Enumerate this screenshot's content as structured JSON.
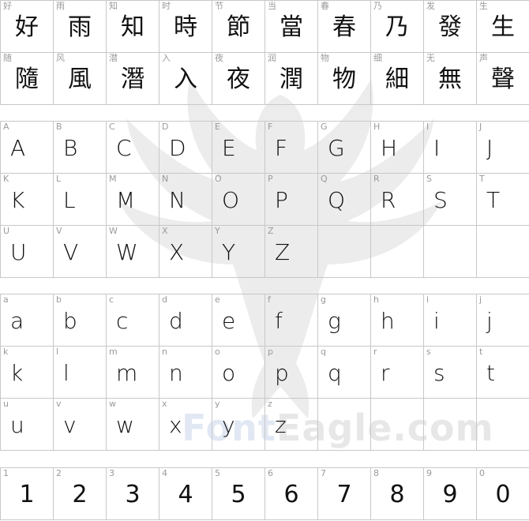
{
  "watermark": {
    "font_word": "Font",
    "eagle_word": "Eagle.com",
    "eagle_icon": "eagle-silhouette-icon"
  },
  "hanzi": {
    "labels": [
      "好",
      "雨",
      "知",
      "时",
      "节",
      "当",
      "春",
      "乃",
      "发",
      "生",
      "随",
      "风",
      "潜",
      "入",
      "夜",
      "润",
      "物",
      "细",
      "无",
      "声"
    ],
    "glyphs": [
      "好",
      "雨",
      "知",
      "時",
      "節",
      "當",
      "春",
      "乃",
      "發",
      "生",
      "隨",
      "風",
      "潛",
      "入",
      "夜",
      "潤",
      "物",
      "細",
      "無",
      "聲"
    ]
  },
  "uppercase": {
    "labels": [
      "A",
      "B",
      "C",
      "D",
      "E",
      "F",
      "G",
      "H",
      "I",
      "J",
      "K",
      "L",
      "M",
      "N",
      "O",
      "P",
      "Q",
      "R",
      "S",
      "T",
      "U",
      "V",
      "W",
      "X",
      "Y",
      "Z"
    ],
    "glyphs": [
      "A",
      "B",
      "C",
      "D",
      "E",
      "F",
      "G",
      "H",
      "I",
      "J",
      "K",
      "L",
      "M",
      "N",
      "O",
      "P",
      "Q",
      "R",
      "S",
      "T",
      "U",
      "V",
      "W",
      "X",
      "Y",
      "Z"
    ]
  },
  "lowercase": {
    "labels": [
      "a",
      "b",
      "c",
      "d",
      "e",
      "f",
      "g",
      "h",
      "i",
      "j",
      "k",
      "l",
      "m",
      "n",
      "o",
      "p",
      "q",
      "r",
      "s",
      "t",
      "u",
      "v",
      "w",
      "x",
      "y",
      "z"
    ],
    "glyphs": [
      "a",
      "b",
      "c",
      "d",
      "e",
      "f",
      "g",
      "h",
      "i",
      "j",
      "k",
      "l",
      "m",
      "n",
      "o",
      "p",
      "q",
      "r",
      "s",
      "t",
      "u",
      "v",
      "w",
      "x",
      "y",
      "z"
    ]
  },
  "digits": {
    "labels": [
      "1",
      "2",
      "3",
      "4",
      "5",
      "6",
      "7",
      "8",
      "9",
      "0"
    ],
    "glyphs": [
      "1",
      "2",
      "3",
      "4",
      "5",
      "6",
      "7",
      "8",
      "9",
      "0"
    ]
  }
}
